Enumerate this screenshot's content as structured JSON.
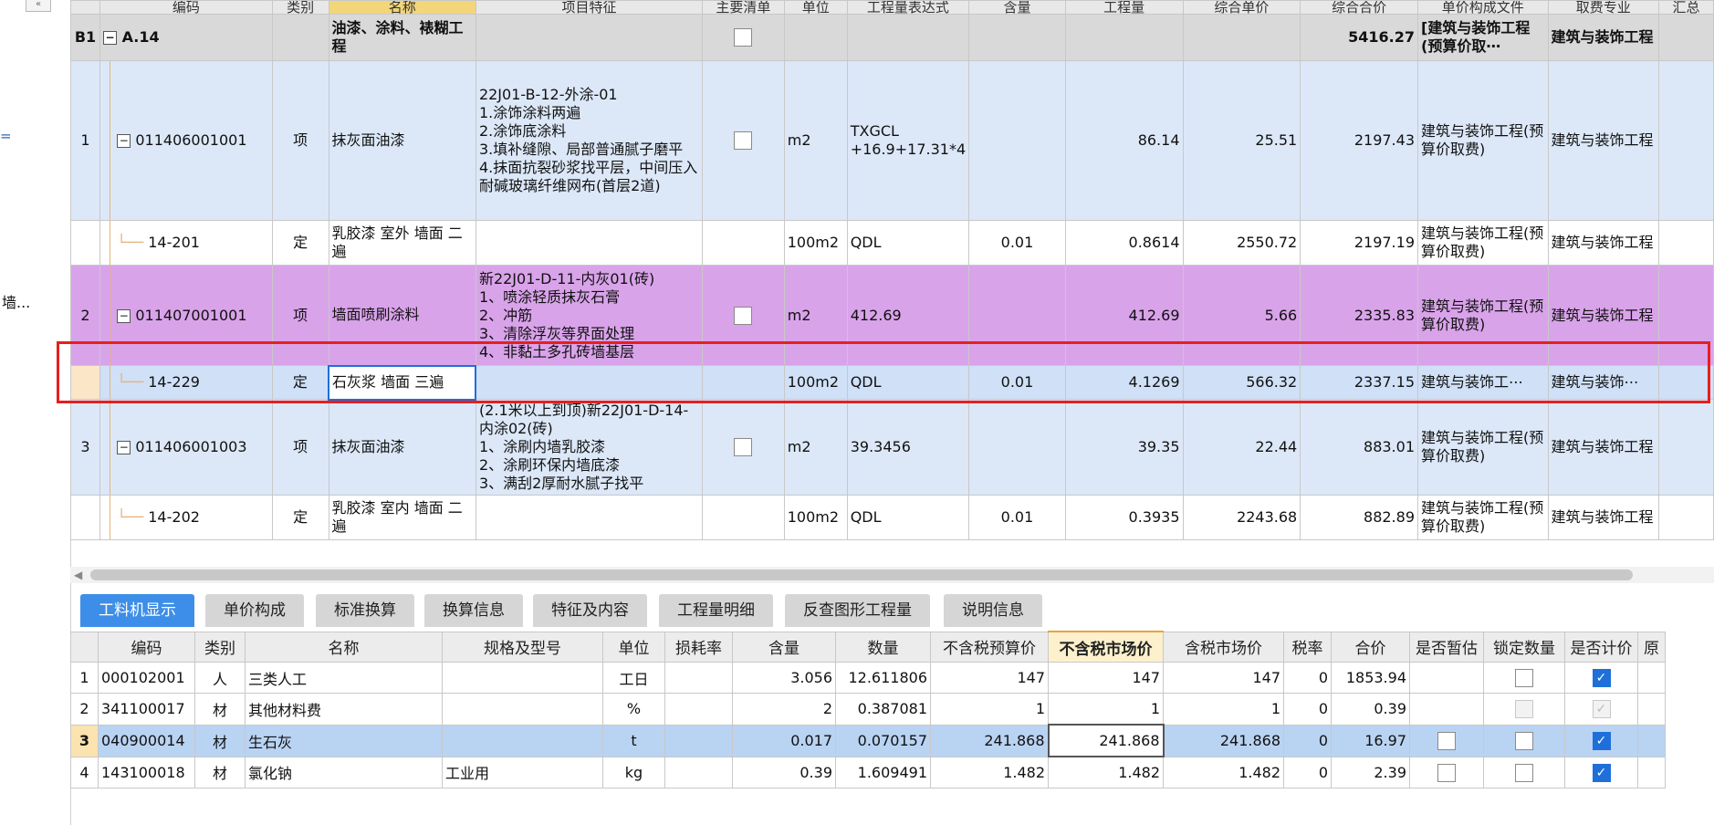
{
  "left_panel": {
    "collapse_label": "«",
    "mark": "=",
    "truncated_text": "墙..."
  },
  "upper_grid": {
    "header": [
      "编码",
      "类别",
      "名称",
      "项目特征",
      "主要清单",
      "单位",
      "工程量表达式",
      "含量",
      "工程量",
      "综合单价",
      "综合合价",
      "单价构成文件",
      "取费专业",
      "汇总"
    ],
    "section": {
      "row": "B1",
      "code": "A.14",
      "name": "油漆、涂料、裱糊工程",
      "total": "5416.27",
      "file": "[建筑与装饰工程(预算价取⋯",
      "specialty": "建筑与装饰工程"
    },
    "rows": [
      {
        "num": "1",
        "code": "011406001001",
        "type": "项",
        "name": "抹灰面油漆",
        "feature": [
          "22J01-B-12-外涂-01",
          "1.涂饰涂料两遍",
          "2.涂饰底涂料",
          "3.填补缝隙、局部普通腻子磨平",
          "4.抹面抗裂砂浆找平层，中间压入耐碱玻璃纤维网布(首层2道)"
        ],
        "unit": "m2",
        "expr": "TXGCL +16.9+17.31*4",
        "ratio": "",
        "qty": "86.14",
        "price": "25.51",
        "total": "2197.43",
        "file": "建筑与装饰工程(预算价取费)",
        "specialty": "建筑与装饰工程"
      },
      {
        "num": "",
        "code": "14-201",
        "type": "定",
        "name": "乳胶漆 室外 墙面 二遍",
        "feature": [],
        "unit": "100m2",
        "expr": "QDL",
        "ratio": "0.01",
        "qty": "0.8614",
        "price": "2550.72",
        "total": "2197.19",
        "file": "建筑与装饰工程(预算价取费)",
        "specialty": "建筑与装饰工程"
      },
      {
        "num": "2",
        "code": "011407001001",
        "type": "项",
        "name": "墙面喷刷涂料",
        "feature": [
          "新22J01-D-11-内灰01(砖)",
          "1、喷涂轻质抹灰石膏",
          "2、冲筋",
          "3、清除浮灰等界面处理",
          "4、非黏土多孔砖墙基层"
        ],
        "unit": "m2",
        "expr": "412.69",
        "ratio": "",
        "qty": "412.69",
        "price": "5.66",
        "total": "2335.83",
        "file": "建筑与装饰工程(预算价取费)",
        "specialty": "建筑与装饰工程"
      },
      {
        "num": "",
        "code": "14-229",
        "type": "定",
        "name": "石灰浆 墙面 三遍",
        "feature": [],
        "unit": "100m2",
        "expr": "QDL",
        "ratio": "0.01",
        "qty": "4.1269",
        "price": "566.32",
        "total": "2337.15",
        "file": "建筑与装饰工⋯",
        "specialty": "建筑与装饰⋯"
      },
      {
        "num": "3",
        "code": "011406001003",
        "type": "项",
        "name": "抹灰面油漆",
        "feature": [
          "(2.1米以上到顶)新22J01-D-14-内涂02(砖)",
          "1、涂刷内墙乳胶漆",
          "2、涂刷环保内墙底漆",
          "3、满刮2厚耐水腻子找平"
        ],
        "unit": "m2",
        "expr": "39.3456",
        "ratio": "",
        "qty": "39.35",
        "price": "22.44",
        "total": "883.01",
        "file": "建筑与装饰工程(预算价取费)",
        "specialty": "建筑与装饰工程"
      },
      {
        "num": "",
        "code": "14-202",
        "type": "定",
        "name": "乳胶漆 室内 墙面 二遍",
        "feature": [],
        "unit": "100m2",
        "expr": "QDL",
        "ratio": "0.01",
        "qty": "0.3935",
        "price": "2243.68",
        "total": "882.89",
        "file": "建筑与装饰工程(预算价取费)",
        "specialty": "建筑与装饰工程"
      }
    ]
  },
  "tabs": [
    "工料机显示",
    "单价构成",
    "标准换算",
    "换算信息",
    "特征及内容",
    "工程量明细",
    "反查图形工程量",
    "说明信息"
  ],
  "lower_grid": {
    "header": [
      "编码",
      "类别",
      "名称",
      "规格及型号",
      "单位",
      "损耗率",
      "含量",
      "数量",
      "不含税预算价",
      "不含税市场价",
      "含税市场价",
      "税率",
      "合价",
      "是否暂估",
      "锁定数量",
      "是否计价",
      "原"
    ],
    "rows": [
      {
        "num": "1",
        "code": "000102001",
        "type": "人",
        "name": "三类人工",
        "spec": "",
        "unit": "工日",
        "loss": "",
        "ratio": "3.056",
        "qty": "12.611806",
        "budget": "147",
        "market": "147",
        "taxed": "147",
        "tax": "0",
        "sum": "1853.94",
        "est": "none",
        "lock": "unchecked",
        "priced": "checked"
      },
      {
        "num": "2",
        "code": "341100017",
        "type": "材",
        "name": "其他材料费",
        "spec": "",
        "unit": "%",
        "loss": "",
        "ratio": "2",
        "qty": "0.387081",
        "budget": "1",
        "market": "1",
        "taxed": "1",
        "tax": "0",
        "sum": "0.39",
        "est": "none",
        "lock": "disabled",
        "priced": "disabled-checked"
      },
      {
        "num": "3",
        "code": "040900014",
        "type": "材",
        "name": "生石灰",
        "spec": "",
        "unit": "t",
        "loss": "",
        "ratio": "0.017",
        "qty": "0.070157",
        "budget": "241.868",
        "market": "241.868",
        "taxed": "241.868",
        "tax": "0",
        "sum": "16.97",
        "est": "unchecked",
        "lock": "unchecked",
        "priced": "checked"
      },
      {
        "num": "4",
        "code": "143100018",
        "type": "材",
        "name": "氯化钠",
        "spec": "工业用",
        "unit": "kg",
        "loss": "",
        "ratio": "0.39",
        "qty": "1.609491",
        "budget": "1.482",
        "market": "1.482",
        "taxed": "1.482",
        "tax": "0",
        "sum": "2.39",
        "est": "unchecked",
        "lock": "unchecked",
        "priced": "checked"
      }
    ]
  },
  "colors": {
    "accent_tab": "#3d8ee8",
    "highlight_frame": "#e81e1e",
    "purple_row": "#d9a3ea",
    "blue_row": "#dce8f8"
  }
}
